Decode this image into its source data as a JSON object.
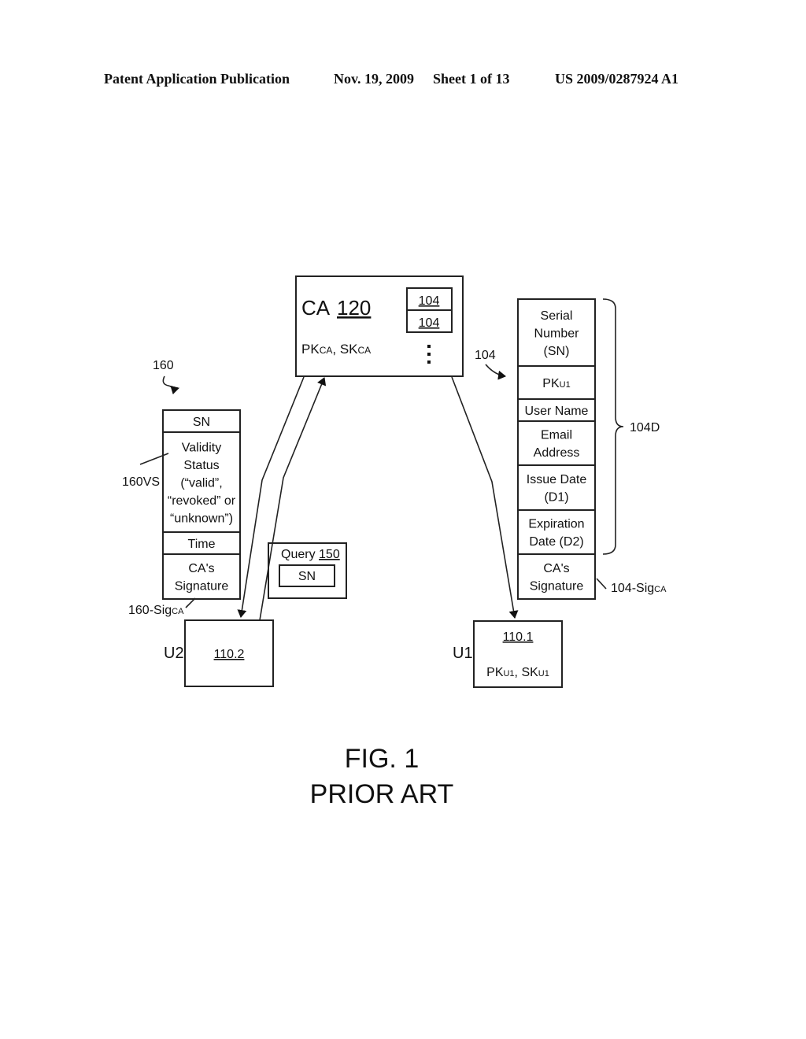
{
  "header": {
    "publication": "Patent Application Publication",
    "date": "Nov. 19, 2009",
    "sheet": "Sheet 1 of 13",
    "number": "US 2009/0287924 A1"
  },
  "ca": {
    "label": "CA",
    "ref": "120",
    "keys_pk": "PK",
    "keys_pk_sub": "CA",
    "keys_sep": ", ",
    "keys_sk": "SK",
    "keys_sk_sub": "CA",
    "stack": [
      "104",
      "104"
    ],
    "ellipsis": "⋮"
  },
  "certificate": {
    "ref": "104",
    "fields": [
      {
        "lines": [
          "Serial",
          "Number",
          "(SN)"
        ]
      },
      {
        "lines": [
          "PK"
        ],
        "sub": "U1"
      },
      {
        "lines": [
          "User Name"
        ]
      },
      {
        "lines": [
          "Email",
          "Address"
        ]
      },
      {
        "lines": [
          "Issue Date",
          "(D1)"
        ]
      },
      {
        "lines": [
          "Expiration",
          "Date (D2)"
        ]
      },
      {
        "lines": [
          "CA's",
          "Signature"
        ]
      }
    ],
    "data_ref": "104D",
    "sig_ref": "104-Sig",
    "sig_ref_sub": "CA"
  },
  "status": {
    "ref": "160",
    "fields": [
      {
        "lines": [
          "SN"
        ]
      },
      {
        "lines": [
          "Validity",
          "Status",
          "(“valid”,",
          "“revoked” or",
          "“unknown”)"
        ]
      },
      {
        "lines": [
          "Time"
        ]
      },
      {
        "lines": [
          "CA's",
          "Signature"
        ]
      }
    ],
    "vs_ref": "160VS",
    "sig_ref": "160-Sig",
    "sig_ref_sub": "CA"
  },
  "query": {
    "label": "Query",
    "ref": "150",
    "field": "SN"
  },
  "user2": {
    "label": "U2",
    "ref": "110.2"
  },
  "user1": {
    "label": "U1",
    "ref": "110.1",
    "pk": "PK",
    "pk_sub": "U1",
    "sep": ", ",
    "sk": "SK",
    "sk_sub": "U1"
  },
  "caption": {
    "fig": "FIG.  1",
    "subtitle": "PRIOR ART"
  }
}
